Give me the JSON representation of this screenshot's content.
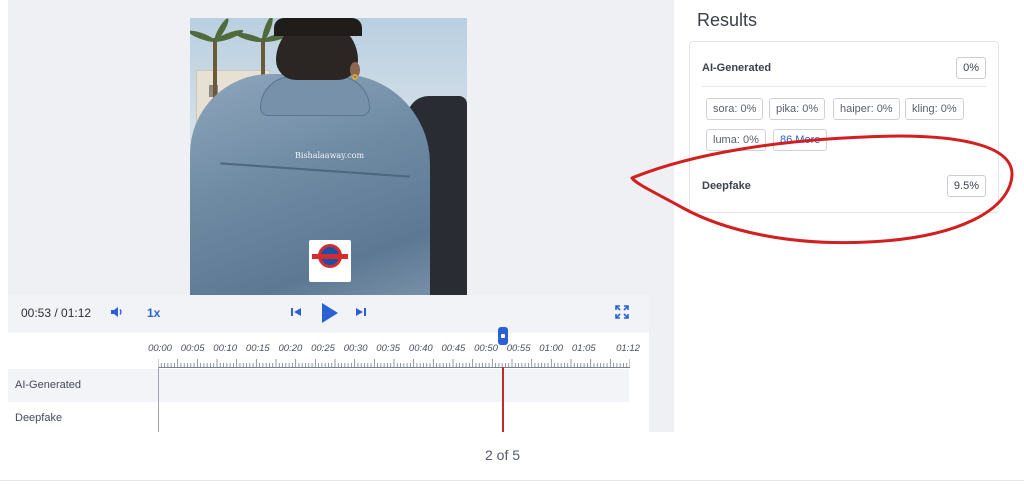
{
  "player": {
    "watermark_text": "Bishalaaway.com",
    "logo_caption": "বিশাল আকাশ",
    "current_time": "00:53 / 01:12",
    "speed": "1x",
    "icons": [
      "volume-icon",
      "skip-back-icon",
      "play-icon",
      "skip-forward-icon",
      "fullscreen-icon"
    ]
  },
  "timeline": {
    "ticks": [
      "00:00",
      "00:05",
      "00:10",
      "00:15",
      "00:20",
      "00:25",
      "00:30",
      "00:35",
      "00:40",
      "00:45",
      "00:50",
      "00:55",
      "01:00",
      "01:05",
      "01:12"
    ],
    "rows": [
      "AI-Generated",
      "Deepfake"
    ],
    "playhead_position_seconds": 53
  },
  "results": {
    "title": "Results",
    "ai_generated": {
      "label": "AI-Generated",
      "value": "0%"
    },
    "models": [
      {
        "label": "sora: 0%"
      },
      {
        "label": "pika: 0%"
      },
      {
        "label": "haiper: 0%"
      },
      {
        "label": "kling: 0%"
      },
      {
        "label": "luma: 0%"
      },
      {
        "label": "86 More"
      }
    ],
    "deepfake": {
      "label": "Deepfake",
      "value": "9.5%"
    }
  },
  "pager": {
    "text": "2 of 5"
  },
  "colors": {
    "accent": "#2a62d6",
    "annotation": "#d21f1f",
    "playhead": "#c32a2a"
  }
}
